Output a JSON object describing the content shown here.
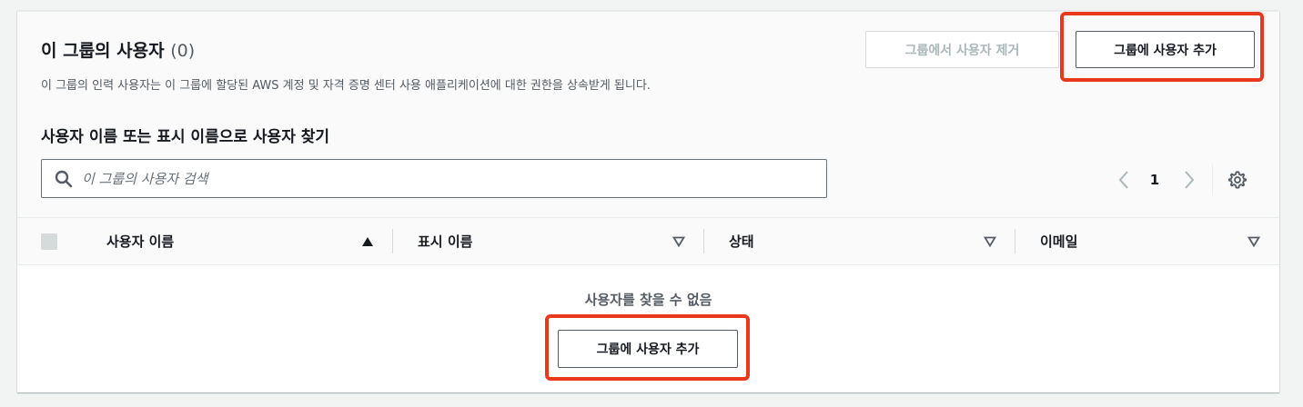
{
  "header": {
    "title": "이 그룹의 사용자",
    "count": "(0)",
    "description": "이 그룹의 인력 사용자는 이 그룹에 할당된 AWS 계정 및 자격 증명 센터 사용 애플리케이션에 대한 권한을 상속받게 됩니다."
  },
  "actions": {
    "remove_label": "그룹에서 사용자 제거",
    "add_label": "그룹에 사용자 추가"
  },
  "search": {
    "label": "사용자 이름 또는 표시 이름으로 사용자 찾기",
    "placeholder": "이 그룹의 사용자 검색",
    "value": ""
  },
  "pagination": {
    "current_page": "1"
  },
  "table": {
    "columns": [
      {
        "label": "사용자 이름",
        "sort": "ascending"
      },
      {
        "label": "표시 이름",
        "sort": "none"
      },
      {
        "label": "상태",
        "sort": "none"
      },
      {
        "label": "이메일",
        "sort": "none"
      }
    ],
    "empty_text": "사용자를 찾을 수 없음",
    "empty_action_label": "그룹에 사용자 추가"
  },
  "colors": {
    "highlight": "#e8391d",
    "panel_bg": "#fafafa",
    "page_bg": "#f2f3f3",
    "text": "#16191f",
    "secondary_text": "#545b64",
    "disabled_text": "#aab7b8"
  },
  "icons": {
    "search": "search-icon",
    "prev": "chevron-left-icon",
    "next": "chevron-right-icon",
    "settings": "gear-icon",
    "sort_asc": "caret-up-icon",
    "sort_none": "caret-down-outline-icon"
  }
}
